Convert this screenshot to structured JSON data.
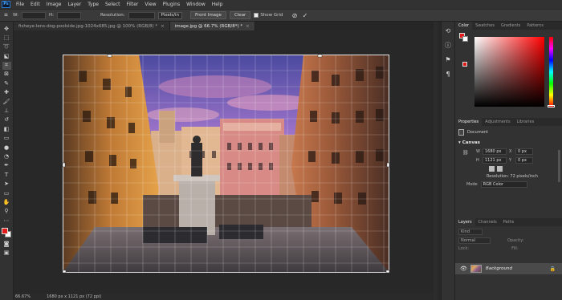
{
  "app": {
    "logo_text": "Ps"
  },
  "menu": [
    "File",
    "Edit",
    "Image",
    "Layer",
    "Type",
    "Select",
    "Filter",
    "View",
    "Plugins",
    "Window",
    "Help"
  ],
  "options": {
    "w_label": "W:",
    "h_label": "H:",
    "resolution_label": "Resolution:",
    "resolution_unit": "Pixels/in",
    "front_image": "Front Image",
    "clear": "Clear",
    "show_grid": "Show Grid",
    "show_grid_checked": true
  },
  "tabs": [
    {
      "label": "fisheye-lens-dog-poolside.jpg-1024x685.jpg @ 100% (RGB/8) *",
      "active": false
    },
    {
      "label": "image.jpg @ 66.7% (RGB/8*) *",
      "active": true
    }
  ],
  "status": {
    "zoom": "66.67%",
    "doc_info": "1680 px x 1121 px (72 ppi)"
  },
  "color_panel": {
    "tabs": [
      "Color",
      "Swatches",
      "Gradients",
      "Patterns"
    ],
    "foreground": "#e21b1b",
    "background": "#ffffff"
  },
  "properties_panel": {
    "tabs": [
      "Properties",
      "Adjustments",
      "Libraries"
    ],
    "doc_label": "Document",
    "canvas_title": "Canvas",
    "w_label": "W",
    "w_value": "1680 px",
    "h_label": "H",
    "h_value": "1121 px",
    "x_label": "X",
    "x_value": "0 px",
    "y_label": "Y",
    "y_value": "0 px",
    "resolution": "Resolution: 72 pixels/inch",
    "mode_label": "Mode",
    "mode_value": "RGB Color"
  },
  "layers_panel": {
    "tabs": [
      "Layers",
      "Channels",
      "Paths"
    ],
    "kind": "Kind",
    "blend_mode": "Normal",
    "opacity_label": "Opacity:",
    "lock_label": "Lock:",
    "fill_label": "Fill:",
    "layer_name": "Background"
  }
}
